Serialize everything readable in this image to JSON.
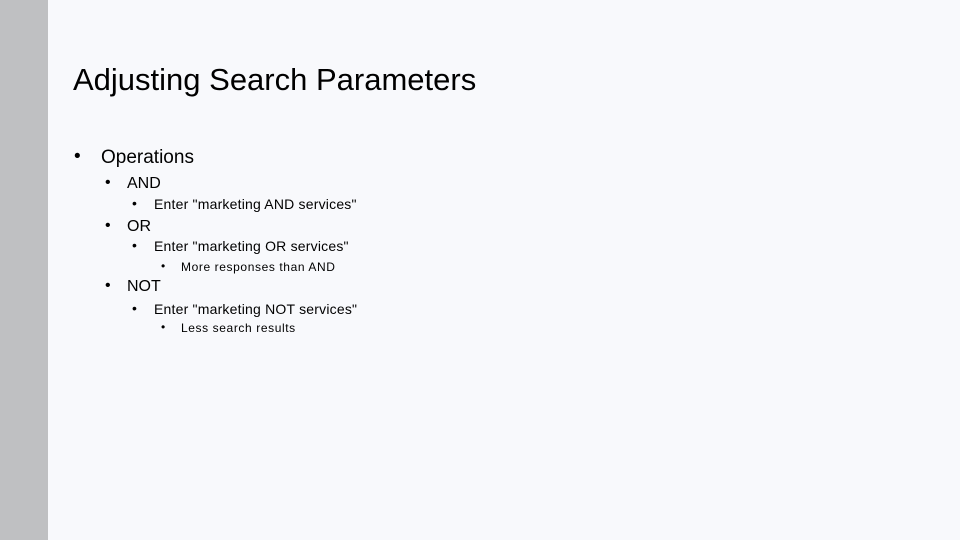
{
  "slide": {
    "title": "Adjusting Search Parameters",
    "bullet_glyph": "•",
    "items": [
      {
        "text": "Operations"
      },
      {
        "text": "AND"
      },
      {
        "text": "Enter \"marketing AND services\""
      },
      {
        "text": "OR"
      },
      {
        "text": "Enter \"marketing OR services\""
      },
      {
        "text": "More responses than AND"
      },
      {
        "text": "NOT"
      },
      {
        "text": "Enter \"marketing NOT services\""
      },
      {
        "text": "Less search results"
      }
    ]
  }
}
